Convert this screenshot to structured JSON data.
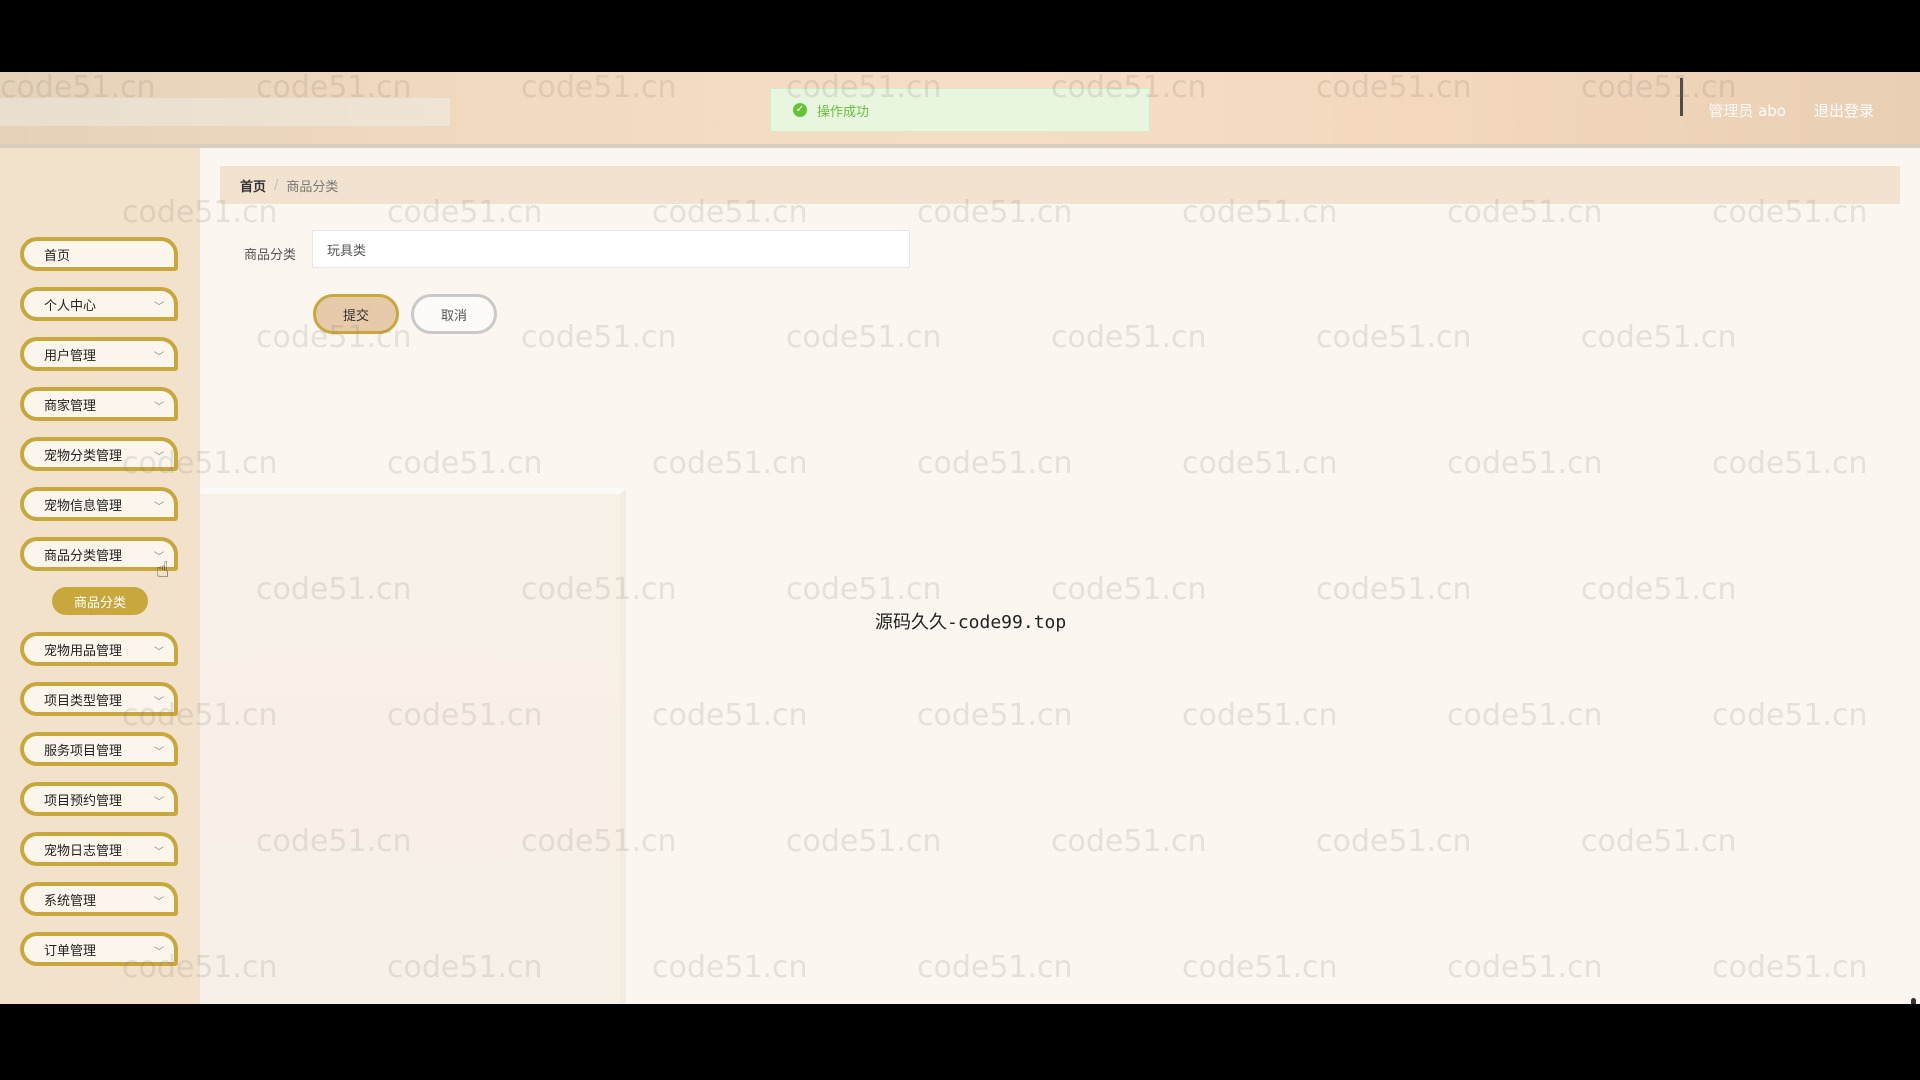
{
  "header": {
    "user_label": "管理员 abo",
    "logout_label": "退出登录"
  },
  "toast": {
    "message": "操作成功",
    "icon": "check-circle-icon",
    "color": "#67c23a"
  },
  "sidebar": {
    "items": [
      {
        "label": "首页",
        "has_submenu": false
      },
      {
        "label": "个人中心",
        "has_submenu": true
      },
      {
        "label": "用户管理",
        "has_submenu": true
      },
      {
        "label": "商家管理",
        "has_submenu": true
      },
      {
        "label": "宠物分类管理",
        "has_submenu": true
      },
      {
        "label": "宠物信息管理",
        "has_submenu": true
      },
      {
        "label": "商品分类管理",
        "has_submenu": true
      },
      {
        "label": "宠物用品管理",
        "has_submenu": true
      },
      {
        "label": "项目类型管理",
        "has_submenu": true
      },
      {
        "label": "服务项目管理",
        "has_submenu": true
      },
      {
        "label": "项目预约管理",
        "has_submenu": true
      },
      {
        "label": "宠物日志管理",
        "has_submenu": true
      },
      {
        "label": "系统管理",
        "has_submenu": true
      },
      {
        "label": "订单管理",
        "has_submenu": true
      }
    ],
    "active_submenu": "商品分类",
    "accent_color": "#c8a83d"
  },
  "breadcrumb": {
    "home": "首页",
    "separator": "/",
    "current": "商品分类"
  },
  "form": {
    "field_label": "商品分类",
    "field_value": "玩具类",
    "submit_label": "提交",
    "cancel_label": "取消"
  },
  "overlay_text": "源码久久-code99.top",
  "watermark": "code51.cn"
}
